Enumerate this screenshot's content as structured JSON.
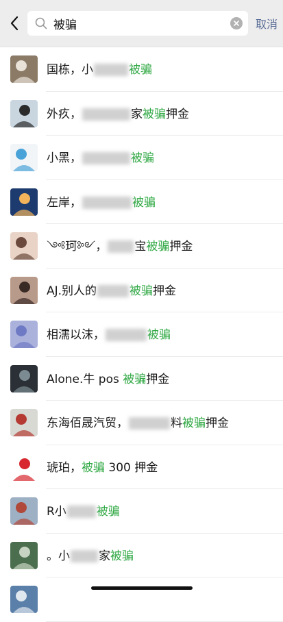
{
  "search": {
    "query": "被骗",
    "cancel_label": "取消"
  },
  "results": [
    {
      "prefix": "国栋，小",
      "keyword": "被骗",
      "suffix": "",
      "blur_w": 50,
      "avatar_bg": "#8a7a66",
      "avatar_fg": "#e9e2d8"
    },
    {
      "prefix": "外疚，",
      "mid": "家",
      "keyword": "被骗",
      "suffix": "押金",
      "blur_w": 70,
      "avatar_bg": "#c9d6e0",
      "avatar_fg": "#2b2b2b"
    },
    {
      "prefix": "小黑，",
      "keyword": "被骗",
      "suffix": "",
      "blur_w": 70,
      "avatar_bg": "#f1f5f8",
      "avatar_fg": "#4aa3d8"
    },
    {
      "prefix": "左岸，",
      "keyword": "被骗",
      "suffix": "",
      "blur_w": 72,
      "avatar_bg": "#1d3b6e",
      "avatar_fg": "#f2b35b"
    },
    {
      "prefix": "༺珂༻，",
      "mid": "宝",
      "keyword": "被骗",
      "suffix": "押金",
      "blur_w": 38,
      "avatar_bg": "#e9d2c6",
      "avatar_fg": "#6b4a3d"
    },
    {
      "prefix": "AJ.别人的",
      "keyword": "被骗",
      "suffix": "押金",
      "blur_w": 46,
      "avatar_bg": "#b89a8a",
      "avatar_fg": "#3a2a26"
    },
    {
      "prefix": "相濡以沫，",
      "keyword": "被骗",
      "suffix": "",
      "blur_w": 60,
      "avatar_bg": "#aab2dc",
      "avatar_fg": "#6f7ac4"
    },
    {
      "prefix": "Alone.牛 pos ",
      "keyword": "被骗",
      "suffix": "押金",
      "blur_w": 0,
      "avatar_bg": "#2b3036",
      "avatar_fg": "#7c8b92"
    },
    {
      "prefix": "东海佰晟汽贸，",
      "mid": "料",
      "keyword": "被骗",
      "suffix": "押金",
      "blur_w": 60,
      "avatar_bg": "#d9d9d4",
      "avatar_fg": "#b43a32"
    },
    {
      "prefix": "琥珀，",
      "keyword": "被骗",
      "suffix": " 300 押金",
      "blur_w": 0,
      "avatar_bg": "#ffffff",
      "avatar_fg": "#d7282f"
    },
    {
      "prefix": "R小",
      "keyword": "被骗",
      "suffix": "",
      "blur_w": 42,
      "avatar_bg": "#9db0c4",
      "avatar_fg": "#b0493a"
    },
    {
      "prefix": "。小",
      "mid": "家",
      "keyword": "被骗",
      "suffix": "",
      "blur_w": 40,
      "avatar_bg": "#4b6e4e",
      "avatar_fg": "#c7d3c2"
    }
  ],
  "partial_row": {
    "avatar_bg": "#5a7fa8"
  },
  "colors": {
    "keyword": "#2fa843",
    "cancel": "#576b95",
    "topbar": "#ededed"
  }
}
